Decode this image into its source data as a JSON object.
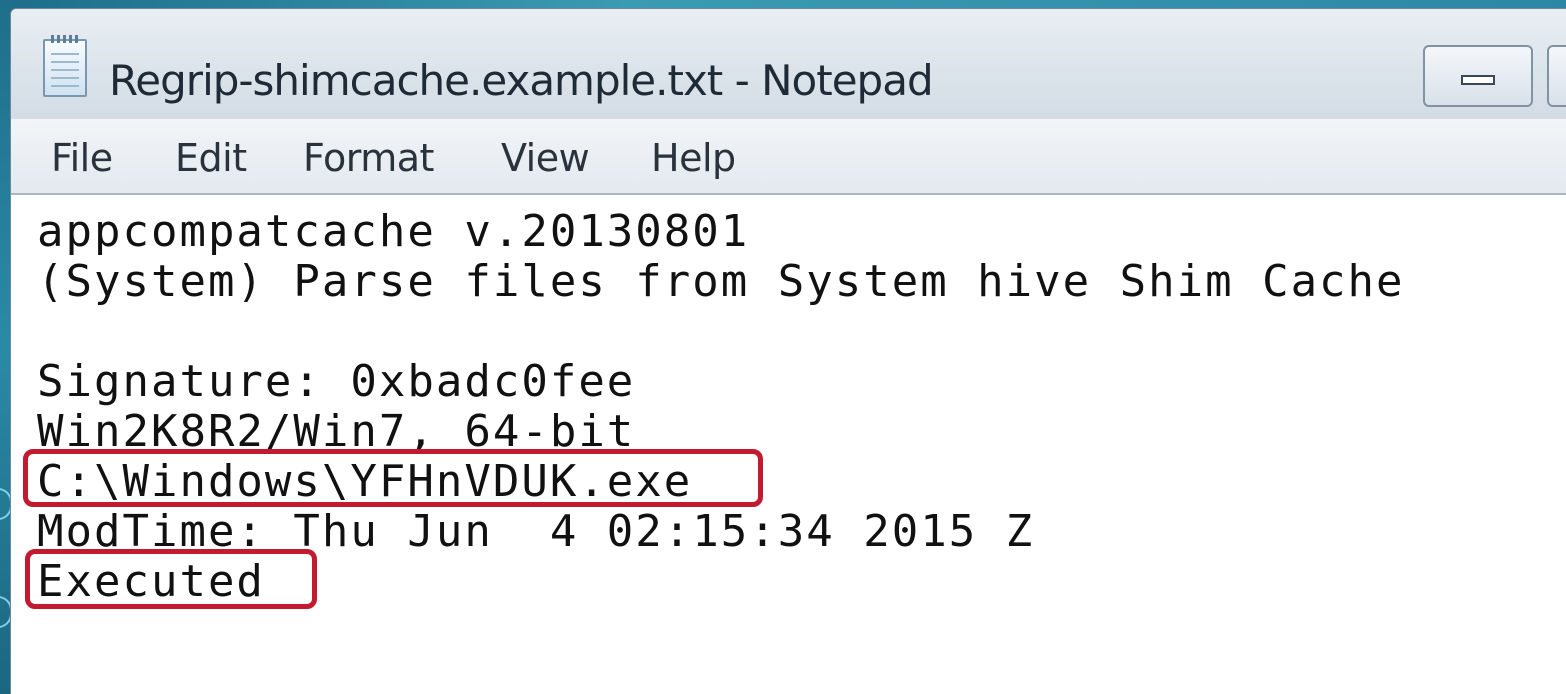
{
  "window": {
    "title": "Regrip-shimcache.example.txt - Notepad"
  },
  "menu": {
    "items": [
      "File",
      "Edit",
      "Format",
      "View",
      "Help"
    ]
  },
  "editor": {
    "lines": [
      "appcompatcache v.20130801",
      "(System) Parse files from System hive Shim Cache",
      "",
      "Signature: 0xbadc0fee",
      "Win2K8R2/Win7, 64-bit",
      "C:\\Windows\\YFHnVDUK.exe",
      "ModTime: Thu Jun  4 02:15:34 2015 Z",
      "Executed"
    ]
  },
  "colors": {
    "highlight": "#c21a2e",
    "editor_background": "#ffffff",
    "titlebar": "#dbe3ea"
  },
  "icons": {
    "app": "notepad-icon",
    "minimize": "minimize-icon",
    "maximize": "maximize-icon"
  }
}
